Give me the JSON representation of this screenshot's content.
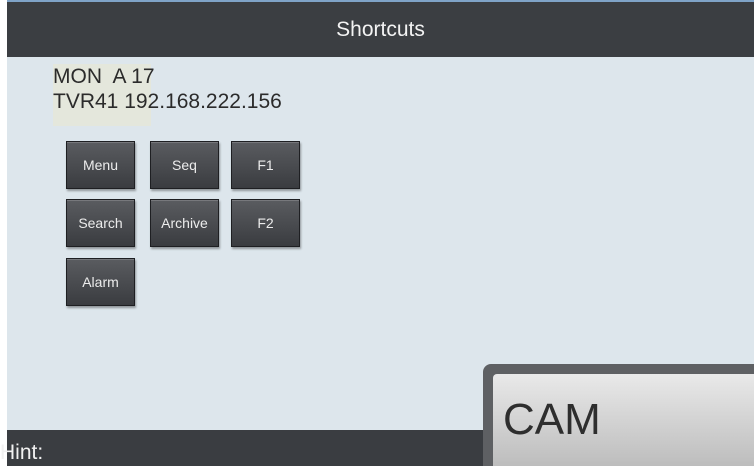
{
  "header": {
    "title": "Shortcuts"
  },
  "info": {
    "monitor": "MON  A 17",
    "device": "TVR41 192.168.222.156"
  },
  "buttons": {
    "menu": "Menu",
    "seq": "Seq",
    "f1": "F1",
    "search": "Search",
    "archive": "Archive",
    "f2": "F2",
    "alarm": "Alarm"
  },
  "hint": {
    "label": "Hint:"
  },
  "cam": {
    "label": "CAM"
  },
  "colors": {
    "background": "#dde6ec",
    "header": "#3b3e42",
    "button": "#4a4c50",
    "hint_bar": "#3a3d41"
  }
}
